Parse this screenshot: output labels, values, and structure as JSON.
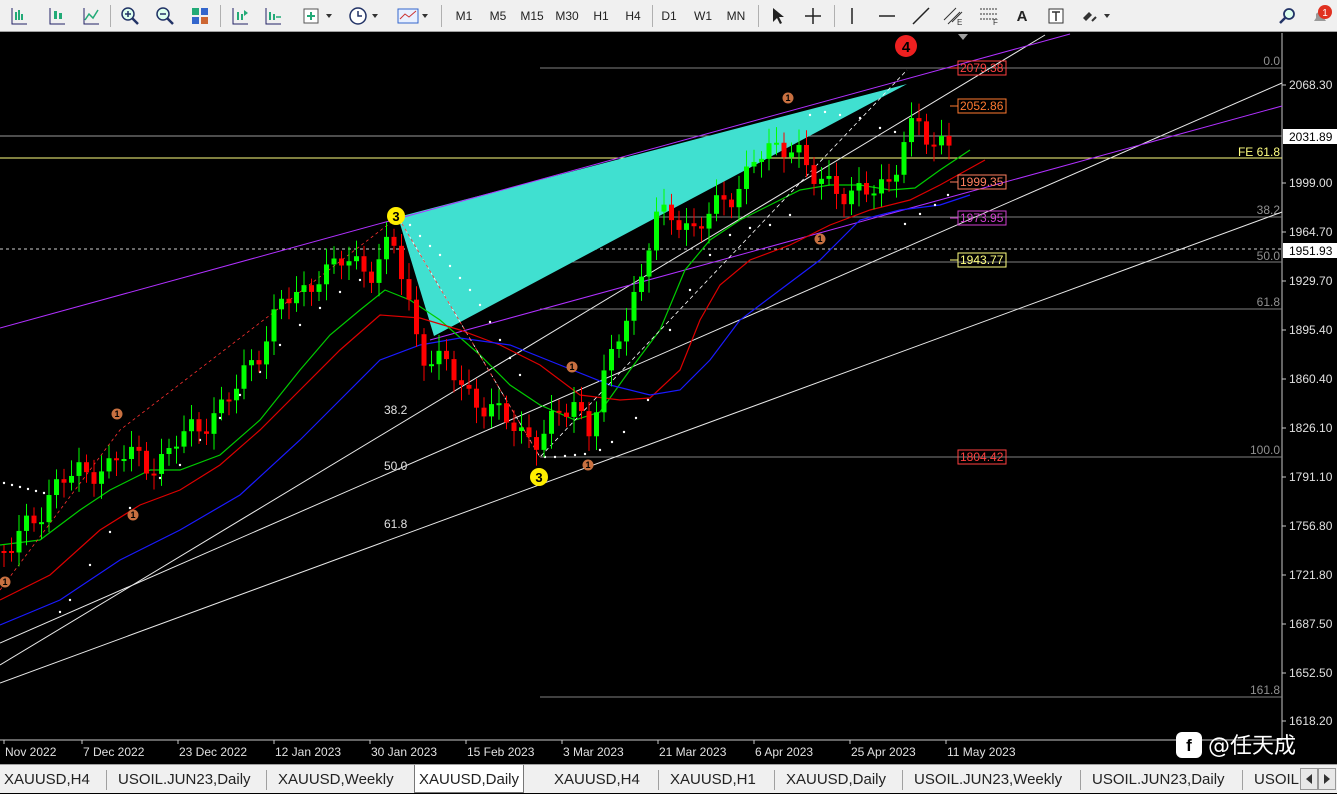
{
  "toolbar": {
    "timeframes": [
      "M1",
      "M5",
      "M15",
      "M30",
      "H1",
      "H4",
      "D1",
      "W1",
      "MN"
    ],
    "notification_count": "1"
  },
  "chart": {
    "price_axis": [
      "2068.30",
      "1999.00",
      "1964.70",
      "1929.70",
      "1895.40",
      "1860.40",
      "1826.10",
      "1791.10",
      "1756.80",
      "1721.80",
      "1687.50",
      "1652.50",
      "1618.20"
    ],
    "current_price": "2031.89",
    "bid_line_price": "1951.93",
    "date_axis": [
      "Nov 2022",
      "7 Dec 2022",
      "23 Dec 2022",
      "12 Jan 2023",
      "30 Jan 2023",
      "15 Feb 2023",
      "3 Mar 2023",
      "21 Mar 2023",
      "6 Apr 2023",
      "25 Apr 2023",
      "11 May 2023"
    ],
    "fe_label": "FE 61.8",
    "fib_right_labels": [
      "0.0",
      "38.2",
      "50.0",
      "61.8",
      "100.0",
      "161.8"
    ],
    "fib_left_labels": [
      "38.2",
      "50.0",
      "61.8"
    ],
    "price_tags": {
      "p2079": "2079.38",
      "p2052": "2052.86",
      "p1999": "1999.35",
      "p1973": "1973.95",
      "p1943": "1943.77",
      "p1804": "1804.42"
    },
    "wave_labels": {
      "w3a": "3",
      "w3b": "3",
      "w4": "4",
      "w1": "1"
    },
    "watermark": "@任天成",
    "colors": {
      "bull": "#00ff00",
      "bear": "#ff0000",
      "wedge": "#40e0d0",
      "ma_fast": "#00cc00",
      "ma_mid": "#dd0000",
      "ma_slow": "#1a1aff",
      "purple": "#b030ff",
      "fib_line": "#808080",
      "fe_line": "#ffff80"
    }
  },
  "tabs": [
    {
      "label": "XAUUSD,H4",
      "active": false
    },
    {
      "label": "USOIL.JUN23,Daily",
      "active": false
    },
    {
      "label": "XAUUSD,Weekly",
      "active": false
    },
    {
      "label": "XAUUSD,Daily",
      "active": true
    },
    {
      "label": "XAUUSD,H4",
      "active": false
    },
    {
      "label": "XAUUSD,H1",
      "active": false
    },
    {
      "label": "XAUUSD,Daily",
      "active": false
    },
    {
      "label": "USOIL.JUN23,Weekly",
      "active": false
    },
    {
      "label": "USOIL.JUN23,Daily",
      "active": false
    },
    {
      "label": "USOIL",
      "active": false
    }
  ]
}
